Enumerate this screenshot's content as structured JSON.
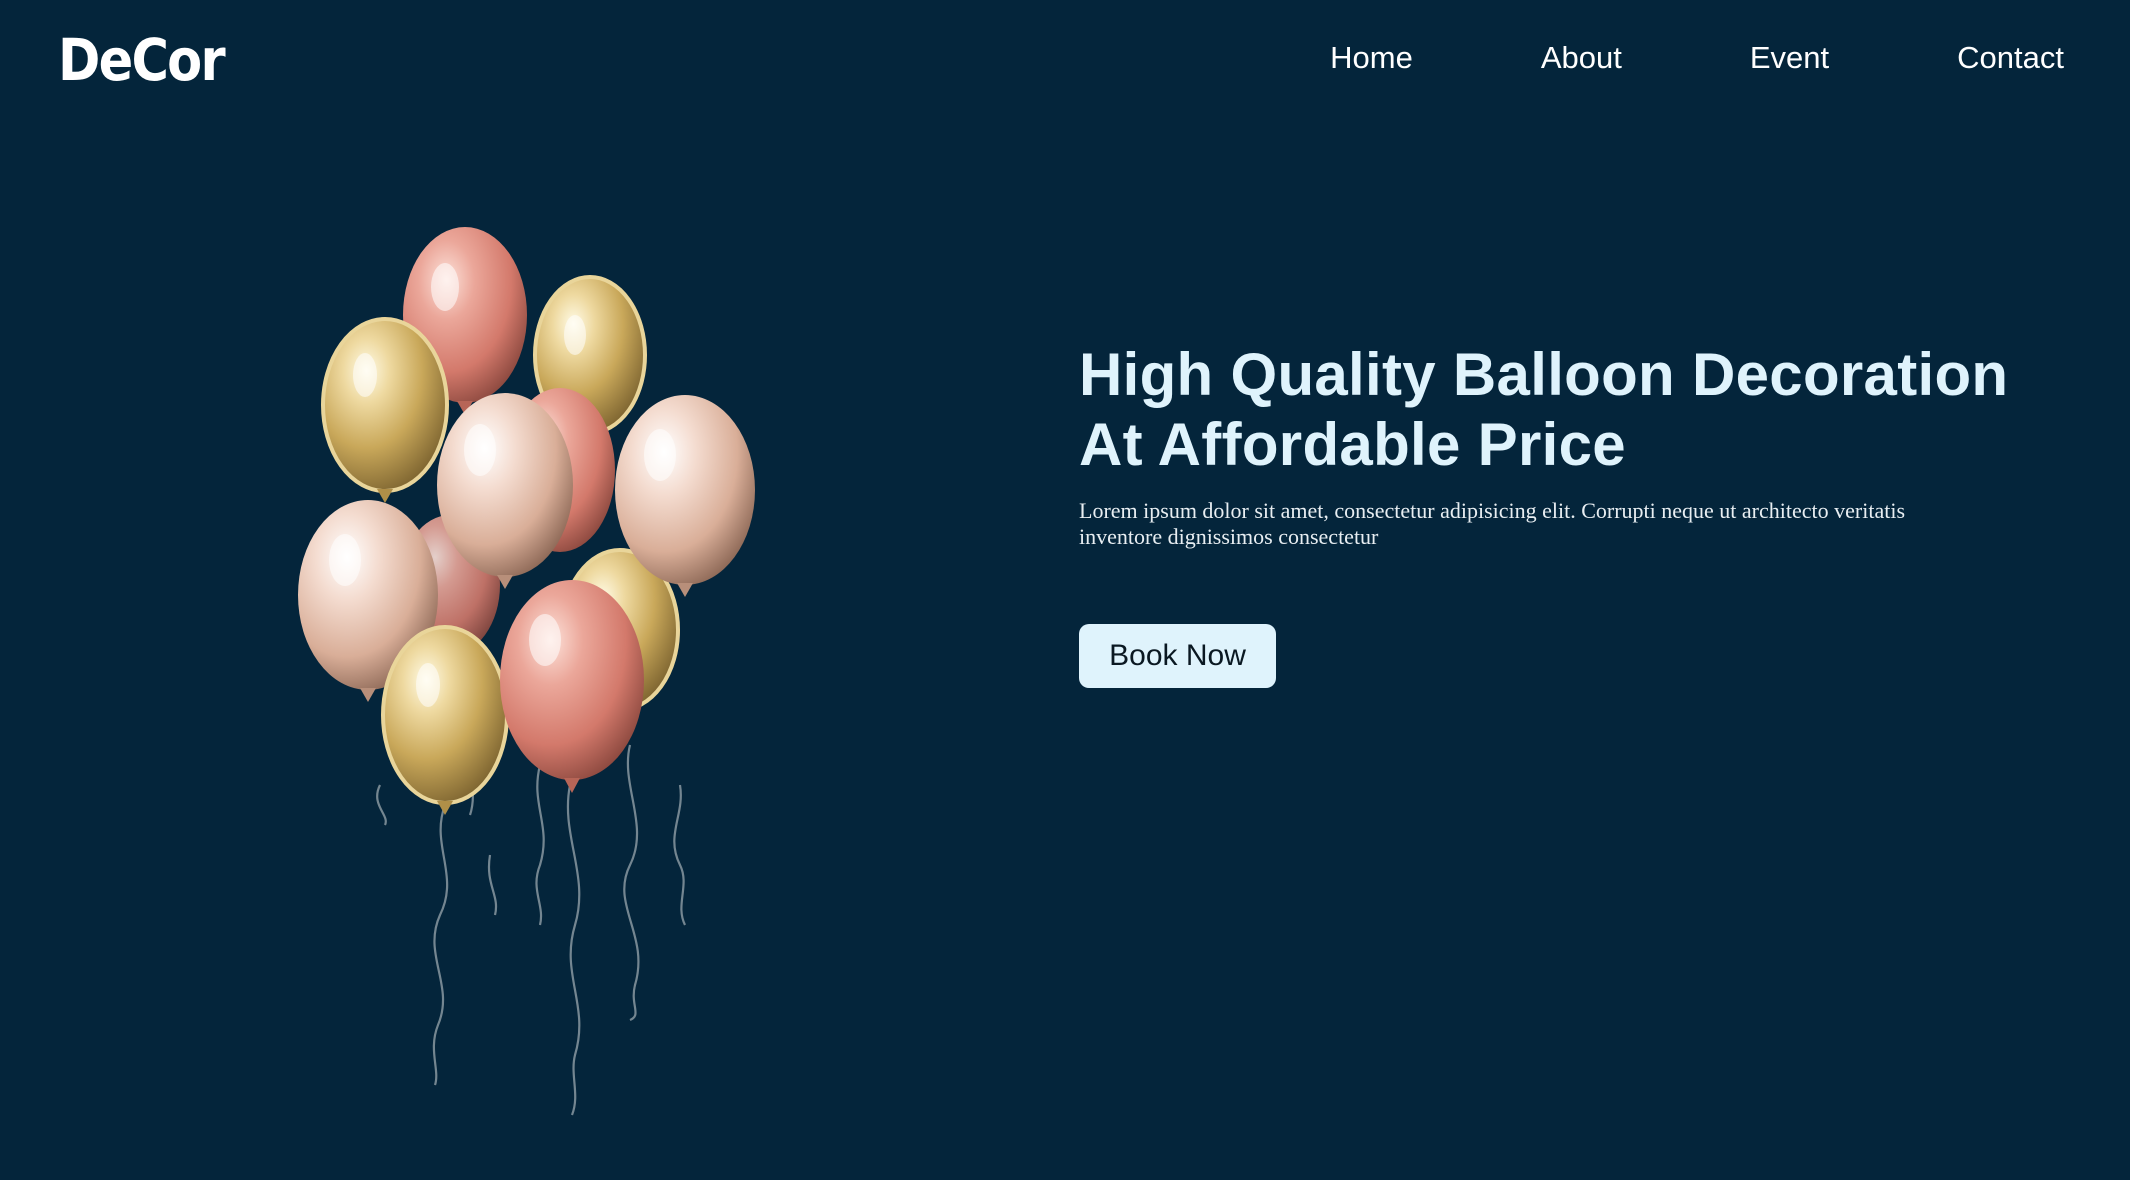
{
  "brand": {
    "logo_text": "DeCor"
  },
  "nav": {
    "items": [
      {
        "label": "Home"
      },
      {
        "label": "About"
      },
      {
        "label": "Event"
      },
      {
        "label": "Contact"
      }
    ]
  },
  "hero": {
    "title_line1": "High Quality Balloon Decoration",
    "title_line2": "At Affordable Price",
    "description": "Lorem ipsum dolor sit amet, consectetur adipisicing elit. Corrupti neque ut architecto veritatis inventore dignissimos consectetur",
    "cta_label": "Book Now",
    "image_icon": "balloon-bouquet-icon"
  },
  "colors": {
    "background": "#04253b",
    "title": "#dff3fc",
    "button_bg": "#dff3fc",
    "balloon_gold": "#d9c07a",
    "balloon_rose": "#e39a8c",
    "balloon_champagne": "#f0d2c3"
  }
}
